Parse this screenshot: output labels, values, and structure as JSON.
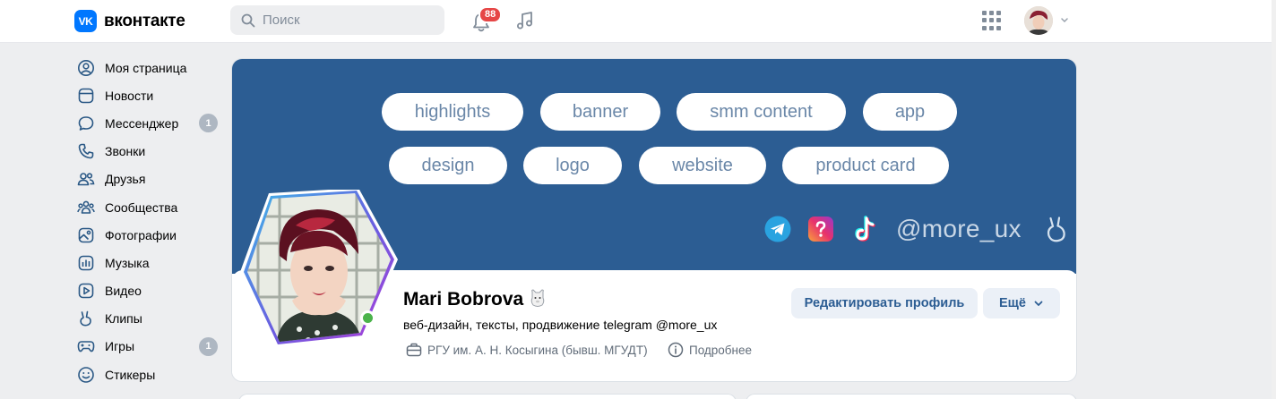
{
  "app": {
    "logo_mark": "VK",
    "logo_text": "вконтакте",
    "brand_color": "#0077ff"
  },
  "search": {
    "placeholder": "Поиск"
  },
  "notifications": {
    "count": "88"
  },
  "sidebar": {
    "items": [
      {
        "label": "Моя страница",
        "icon": "user-circle-icon"
      },
      {
        "label": "Новости",
        "icon": "news-icon"
      },
      {
        "label": "Мессенджер",
        "icon": "message-icon",
        "count": "1"
      },
      {
        "label": "Звонки",
        "icon": "phone-icon"
      },
      {
        "label": "Друзья",
        "icon": "friends-icon"
      },
      {
        "label": "Сообщества",
        "icon": "communities-icon"
      },
      {
        "label": "Фотографии",
        "icon": "photo-icon"
      },
      {
        "label": "Музыка",
        "icon": "music-icon"
      },
      {
        "label": "Видео",
        "icon": "video-icon"
      },
      {
        "label": "Клипы",
        "icon": "clips-icon"
      },
      {
        "label": "Игры",
        "icon": "gamepad-icon",
        "count": "1"
      },
      {
        "label": "Стикеры",
        "icon": "sticker-icon"
      }
    ]
  },
  "cover": {
    "background": "#2c5d93",
    "tags_row1": [
      "highlights",
      "banner",
      "smm content",
      "app"
    ],
    "tags_row2": [
      "design",
      "logo",
      "website",
      "product card"
    ],
    "handle": "@more_ux"
  },
  "profile": {
    "name": "Mari Bobrova",
    "status": "веб-дизайн, тексты, продвижение telegram @more_ux",
    "university": "РГУ им. А. Н. Косыгина (бывш. МГУДТ)",
    "more_info": "Подробнее",
    "edit_button": "Редактировать профиль",
    "more_button": "Ещё",
    "online": true
  }
}
